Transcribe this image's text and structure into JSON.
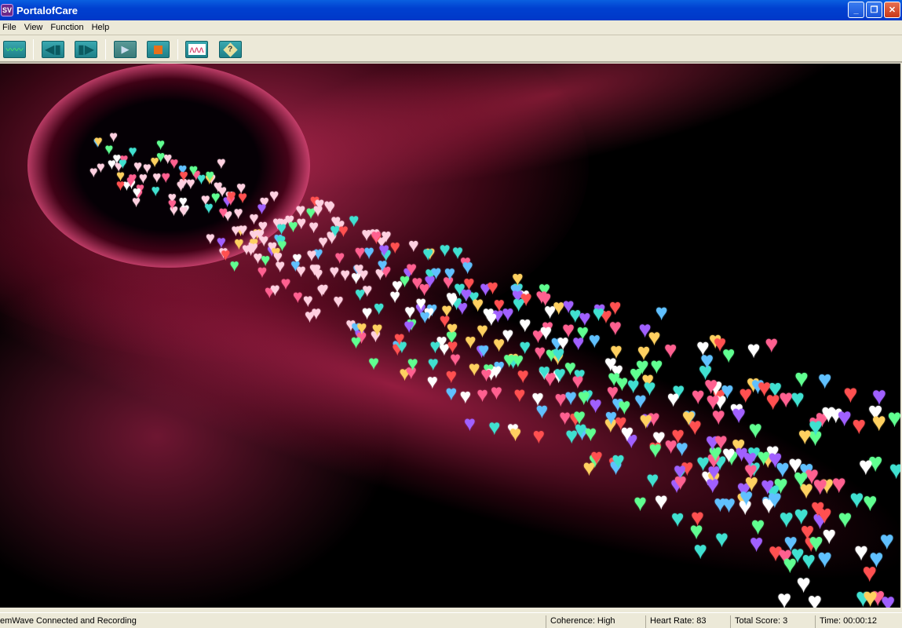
{
  "window": {
    "title": "PortalofCare",
    "icon": "SV"
  },
  "menu": [
    "File",
    "View",
    "Function",
    "Help"
  ],
  "toolbar": [
    "waveform-icon",
    "back-icon",
    "forward-icon",
    "play-icon",
    "stop-icon",
    "chart-icon",
    "help-icon"
  ],
  "status": {
    "message": "emWave Connected and Recording",
    "coherence": "Coherence: High",
    "heart_rate": "Heart Rate: 83",
    "total_score": "Total Score: 3",
    "time": "Time: 00:00:12"
  },
  "colors": {
    "accent": "#d02a5a",
    "heart_colors": [
      "#ff6090",
      "#ffd060",
      "#60c0ff",
      "#a060ff",
      "#60ff90",
      "#ff5050",
      "#ffffff",
      "#40e0d0"
    ]
  }
}
